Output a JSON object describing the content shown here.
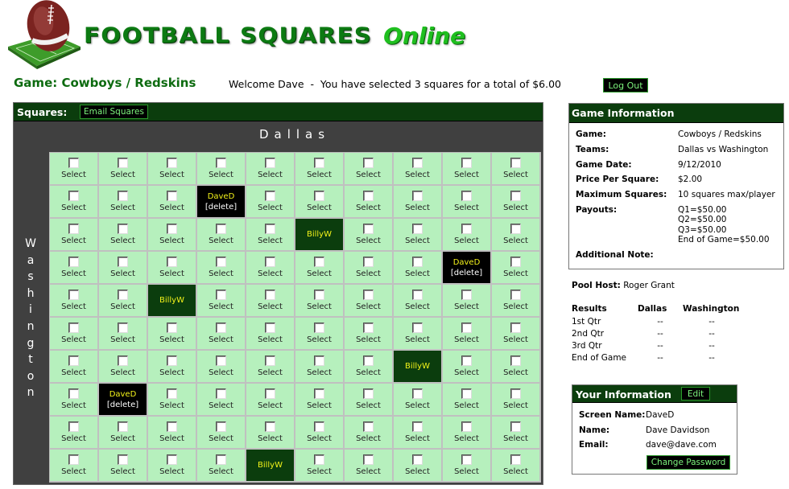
{
  "header": {
    "logo_icon": "football-on-field-icon",
    "logo_main": "FOOTBALL SQUARES",
    "logo_online": "Online"
  },
  "game_title": "Game: Cowboys / Redskins",
  "welcome_text": "Welcome Dave  -  You have selected 3 squares for a total of $6.00",
  "logout_label": "Log Out",
  "squares": {
    "label": "Squares:",
    "email_button": "Email Squares",
    "column_team": "Dallas",
    "row_team_letters": [
      "W",
      "a",
      "s",
      "h",
      "i",
      "n",
      "g",
      "t",
      "o",
      "n"
    ],
    "select_label": "Select",
    "delete_label": "[delete]",
    "rows": [
      [
        "select",
        "select",
        "select",
        "select",
        "select",
        "select",
        "select",
        "select",
        "select",
        "select"
      ],
      [
        "select",
        "select",
        "select",
        {
          "owner": "DaveD",
          "mine": true
        },
        "select",
        "select",
        "select",
        "select",
        "select",
        "select"
      ],
      [
        "select",
        "select",
        "select",
        "select",
        "select",
        {
          "owner": "BillyW",
          "mine": false
        },
        "select",
        "select",
        "select",
        "select"
      ],
      [
        "select",
        "select",
        "select",
        "select",
        "select",
        "select",
        "select",
        "select",
        {
          "owner": "DaveD",
          "mine": true
        },
        "select"
      ],
      [
        "select",
        "select",
        {
          "owner": "BillyW",
          "mine": false
        },
        "select",
        "select",
        "select",
        "select",
        "select",
        "select",
        "select"
      ],
      [
        "select",
        "select",
        "select",
        "select",
        "select",
        "select",
        "select",
        "select",
        "select",
        "select"
      ],
      [
        "select",
        "select",
        "select",
        "select",
        "select",
        "select",
        "select",
        {
          "owner": "BillyW",
          "mine": false
        },
        "select",
        "select"
      ],
      [
        "select",
        {
          "owner": "DaveD",
          "mine": true
        },
        "select",
        "select",
        "select",
        "select",
        "select",
        "select",
        "select",
        "select"
      ],
      [
        "select",
        "select",
        "select",
        "select",
        "select",
        "select",
        "select",
        "select",
        "select",
        "select"
      ],
      [
        "select",
        "select",
        "select",
        "select",
        {
          "owner": "BillyW",
          "mine": false
        },
        "select",
        "select",
        "select",
        "select",
        "select"
      ]
    ]
  },
  "game_info": {
    "title": "Game Information",
    "rows": [
      {
        "label": "Game:",
        "value": "Cowboys / Redskins"
      },
      {
        "label": "Teams:",
        "value": "Dallas vs Washington"
      },
      {
        "label": "Game Date:",
        "value": "9/12/2010"
      },
      {
        "label": "Price Per Square:",
        "value": "$2.00"
      },
      {
        "label": "Maximum Squares:",
        "value": "10 squares max/player"
      },
      {
        "label": "Payouts:",
        "value": [
          "Q1=$50.00",
          "Q2=$50.00",
          "Q3=$50.00",
          "End of Game=$50.00"
        ]
      },
      {
        "label": "Additional Note:",
        "value": ""
      }
    ]
  },
  "pool_host": {
    "label": "Pool Host:",
    "value": "Roger Grant"
  },
  "results": {
    "headers": [
      "Results",
      "Dallas",
      "Washington"
    ],
    "rows": [
      [
        "1st Qtr",
        "--",
        "--"
      ],
      [
        "2nd Qtr",
        "--",
        "--"
      ],
      [
        "3rd Qtr",
        "--",
        "--"
      ],
      [
        "End of Game",
        "--",
        "--"
      ]
    ]
  },
  "your_info": {
    "title": "Your Information",
    "edit_label": "Edit",
    "rows": [
      {
        "label": "Screen Name:",
        "value": "DaveD"
      },
      {
        "label": "Name:",
        "value": "Dave Davidson"
      },
      {
        "label": "Email:",
        "value": "dave@dave.com"
      }
    ],
    "change_password_label": "Change Password"
  },
  "colors": {
    "brand_green": "#0c7a12",
    "header_bar": "#0b3d0d",
    "square_bg": "#b6f0bd",
    "button_text": "#7cf27c",
    "owner_text": "#f2f21a"
  }
}
